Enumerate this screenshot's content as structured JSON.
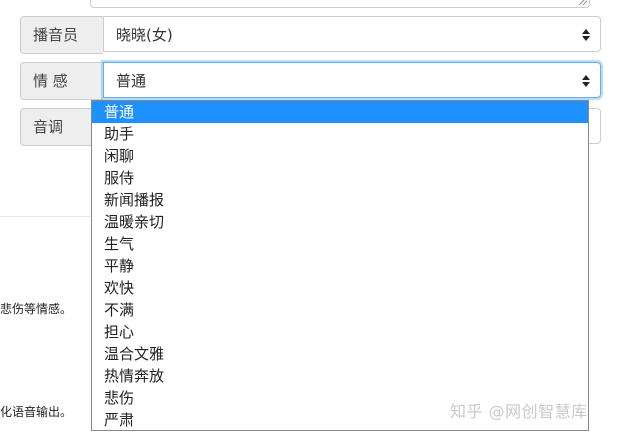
{
  "form": {
    "announcer": {
      "label": "播音员",
      "value": "晓晓(女)"
    },
    "emotion": {
      "label": "情 感",
      "value": "普通"
    },
    "tone": {
      "label": "音调"
    }
  },
  "emotion_options": [
    "普通",
    "助手",
    "闲聊",
    "服侍",
    "新闻播报",
    "温暖亲切",
    "生气",
    "平静",
    "欢快",
    "不满",
    "担心",
    "温合文雅",
    "热情奔放",
    "悲伤",
    "严肃"
  ],
  "selected_option_index": 0,
  "side_texts": {
    "line1": "悲伤等情感。",
    "line2": "化语音输出。"
  },
  "watermark": "知乎 @网创智慧库",
  "colors": {
    "highlight": "#1e90ff",
    "focus_border": "#66afe9",
    "addon_bg": "#eeeeee"
  }
}
